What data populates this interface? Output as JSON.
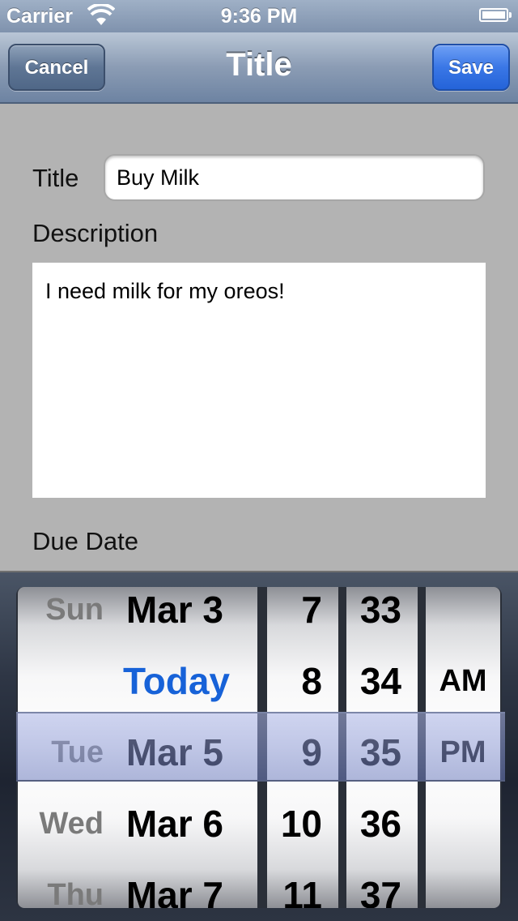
{
  "status_bar": {
    "carrier": "Carrier",
    "time": "9:36 PM"
  },
  "nav": {
    "cancel_label": "Cancel",
    "title": "Title",
    "save_label": "Save"
  },
  "form": {
    "title_label": "Title",
    "title_value": "Buy Milk",
    "description_label": "Description",
    "description_value": "I need milk for my oreos!",
    "due_date_label": "Due Date"
  },
  "picker": {
    "dates": [
      {
        "day": "Sun",
        "date": "Mar 3"
      },
      {
        "day": "",
        "date": "Today"
      },
      {
        "day": "Tue",
        "date": "Mar 5"
      },
      {
        "day": "Wed",
        "date": "Mar 6"
      },
      {
        "day": "Thu",
        "date": "Mar 7"
      }
    ],
    "hours": [
      "7",
      "8",
      "9",
      "10",
      "11"
    ],
    "minutes": [
      "33",
      "34",
      "35",
      "36",
      "37"
    ],
    "ampm": [
      "",
      "AM",
      "PM",
      "",
      ""
    ]
  },
  "colors": {
    "accent": "#1762d8",
    "save_button": "#3a77e6",
    "background": "#b3b3b3"
  }
}
